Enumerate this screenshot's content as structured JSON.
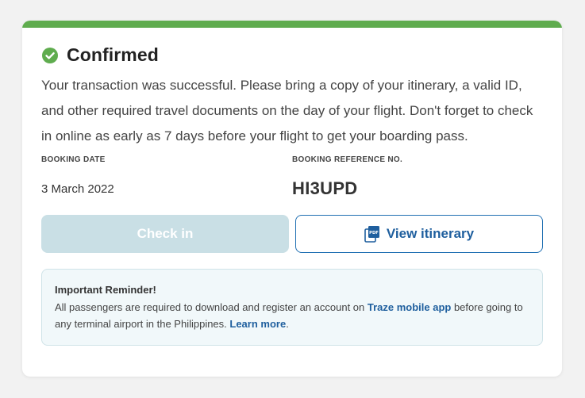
{
  "status": {
    "title": "Confirmed",
    "icon": "check-circle-icon",
    "accent_color": "#5fac4e"
  },
  "message": "Your transaction was successful. Please bring a copy of your itinerary, a valid ID, and other required travel documents on the day of your flight. Don't forget to check in online as early as 7 days before your flight to get your boarding pass.",
  "booking": {
    "date_label": "BOOKING DATE",
    "date_value": "3 March 2022",
    "reference_label": "BOOKING REFERENCE NO.",
    "reference_value": "HI3UPD"
  },
  "buttons": {
    "check_in": "Check in",
    "view_itinerary": "View itinerary",
    "itinerary_icon": "pdf-icon",
    "itinerary_color": "#1f5f9e"
  },
  "reminder": {
    "title": "Important Reminder!",
    "text_before_app": "All passengers are required to download and register an account on ",
    "app_link": "Traze mobile app",
    "text_after_app": " before going to any terminal airport in the Philippines. ",
    "learn_more": "Learn more",
    "end_period": "."
  }
}
